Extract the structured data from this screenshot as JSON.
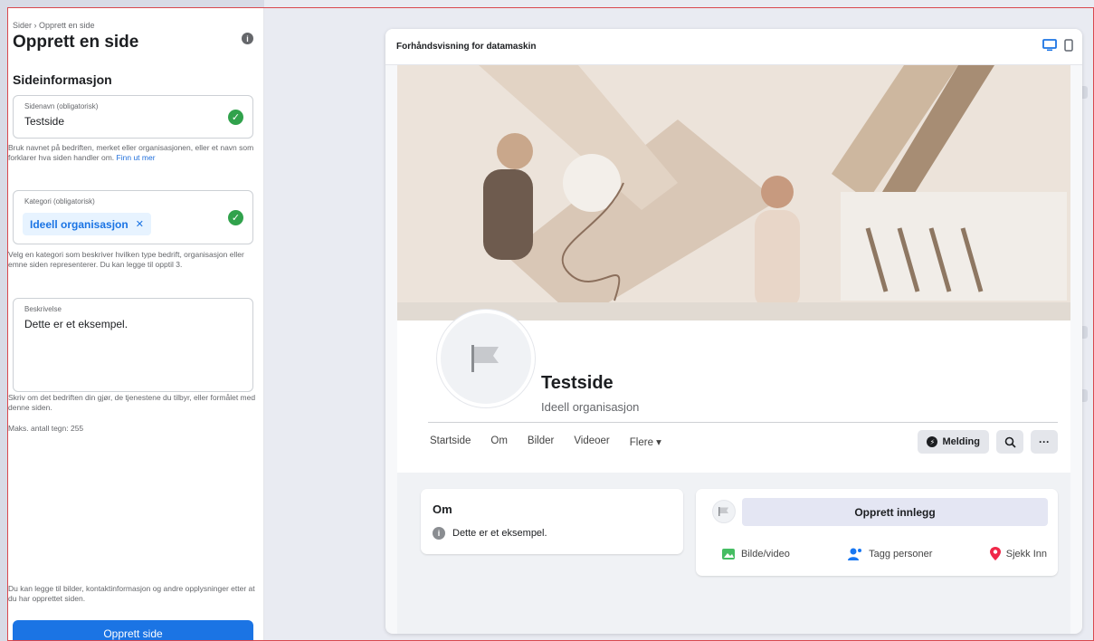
{
  "sidebar": {
    "breadcrumb": "Sider › Opprett en side",
    "title": "Opprett en side",
    "section_title": "Sideinformasjon",
    "page_name": {
      "label": "Sidenavn (obligatorisk)",
      "value": "Testside",
      "help": "Bruk navnet på bedriften, merket eller organisasjonen, eller et navn som forklarer hva siden handler om.",
      "help_link": "Finn ut mer"
    },
    "category": {
      "label": "Kategori (obligatorisk)",
      "chip": "Ideell organisasjon",
      "help": "Velg en kategori som beskriver hvilken type bedrift, organisasjon eller emne siden representerer. Du kan legge til opptil 3."
    },
    "description": {
      "label": "Beskrivelse",
      "value": "Dette er et eksempel.",
      "help": "Skriv om det bedriften din gjør, de tjenestene du tilbyr, eller formålet med denne siden.",
      "max": "Maks. antall tegn: 255"
    },
    "footer_note": "Du kan legge til bilder, kontaktinformasjon og andre opplysninger etter at du har opprettet siden.",
    "create_button": "Opprett side"
  },
  "preview": {
    "header": "Forhåndsvisning for datamaskin",
    "page_name": "Testside",
    "page_category": "Ideell organisasjon",
    "tabs": [
      "Startside",
      "Om",
      "Bilder",
      "Videoer",
      "Flere ▾"
    ],
    "message_button": "Melding",
    "about_title": "Om",
    "about_text": "Dette er et eksempel.",
    "create_post": "Opprett innlegg",
    "post_actions": [
      "Bilde/video",
      "Tagg personer",
      "Sjekk Inn"
    ]
  },
  "colors": {
    "accent": "#1b74e4",
    "success": "#31a24c",
    "frame": "#d9484e"
  },
  "icons": [
    "info-icon",
    "check-icon",
    "close-icon",
    "desktop-icon",
    "mobile-icon",
    "messenger-icon",
    "search-icon",
    "more-icon",
    "flag-icon",
    "photo-icon",
    "tag-people-icon",
    "check-in-icon"
  ]
}
